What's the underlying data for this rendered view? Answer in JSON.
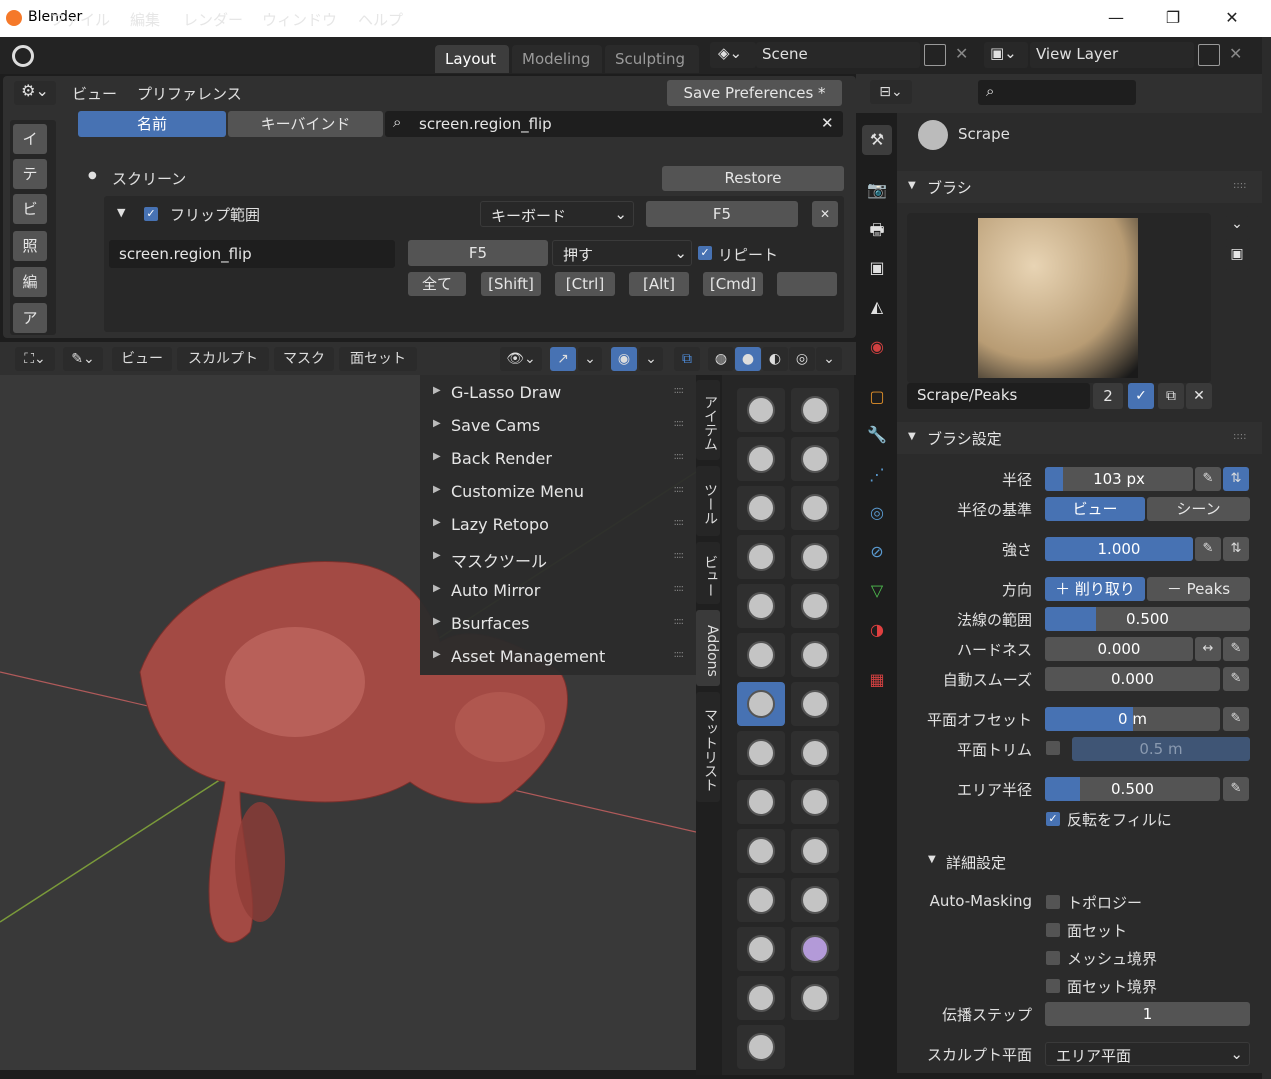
{
  "window": {
    "title": "Blender",
    "minimize": "—",
    "restore": "❐",
    "close": "✕"
  },
  "menubar": {
    "items": [
      "ファイル",
      "編集",
      "レンダー",
      "ウィンドウ",
      "ヘルプ"
    ],
    "workspaces": [
      "Layout",
      "Modeling",
      "Sculpting"
    ],
    "scene": "Scene",
    "view_layer": "View Layer"
  },
  "preferences": {
    "header_items": [
      "ビュー",
      "プリファレンス"
    ],
    "save_button": "Save Preferences *",
    "side_tabs": [
      "イ",
      "テ",
      "ビ",
      "照",
      "編",
      "ア"
    ],
    "tab_name": "名前",
    "tab_keybind": "キーバインド",
    "search_value": "screen.region_flip",
    "section": "スクリーン",
    "restore": "Restore",
    "item_label": "フリップ範囲",
    "input_type": "キーボード",
    "key": "F5",
    "operator": "screen.region_flip",
    "event_key": "F5",
    "event_value": "押す",
    "repeat": "リピート",
    "mods": [
      "全て",
      "[Shift]",
      "[Ctrl]",
      "[Alt]",
      "[Cmd]"
    ]
  },
  "viewport": {
    "header": [
      "ビュー",
      "スカルプト",
      "マスク",
      "面セット"
    ],
    "addons": [
      "G-Lasso Draw",
      "Save Cams",
      "Back Render",
      "Customize Menu",
      "Lazy Retopo",
      "マスクツール",
      "Auto Mirror",
      "Bsurfaces",
      "Asset Management"
    ],
    "side_tabs": [
      "アイテム",
      "ツール",
      "ビュー",
      "Addons",
      "マットリスト"
    ]
  },
  "properties": {
    "brush_name": "Scrape",
    "panel_brush": "ブラシ",
    "brush_slot": "Scrape/Peaks",
    "brush_users": "2",
    "panel_brush_settings": "ブラシ設定",
    "radius_label": "半径",
    "radius_value": "103 px",
    "radius_fill": 0.12,
    "radius_unit_label": "半径の基準",
    "radius_unit_view": "ビュー",
    "radius_unit_scene": "シーン",
    "strength_label": "強さ",
    "strength_value": "1.000",
    "strength_fill": 1.0,
    "direction_label": "方向",
    "direction_add": "＋ 削り取り",
    "direction_sub": "－   Peaks",
    "normal_radius_label": "法線の範囲",
    "normal_radius_value": "0.500",
    "normal_radius_fill": 0.25,
    "hardness_label": "ハードネス",
    "hardness_value": "0.000",
    "autosmooth_label": "自動スムーズ",
    "autosmooth_value": "0.000",
    "plane_offset_label": "平面オフセット",
    "plane_offset_value": "0 m",
    "plane_offset_fill": 0.5,
    "plane_trim_label": "平面トリム",
    "plane_trim_value": "0.5 m",
    "area_radius_label": "エリア半径",
    "area_radius_value": "0.500",
    "area_radius_fill": 0.2,
    "invert_fill": "反転をフィルに",
    "advanced": "詳細設定",
    "automasking_label": "Auto-Masking",
    "automasking": [
      "トポロジー",
      "面セット",
      "メッシュ境界",
      "面セット境界"
    ],
    "propagation_label": "伝播ステップ",
    "propagation_value": "1",
    "sculpt_plane_label": "スカルプト平面",
    "sculpt_plane_value": "エリア平面"
  },
  "colors": {
    "accent": "#4772b3",
    "active_tab": "#3d3d3d",
    "mesh": "#a34a44"
  }
}
